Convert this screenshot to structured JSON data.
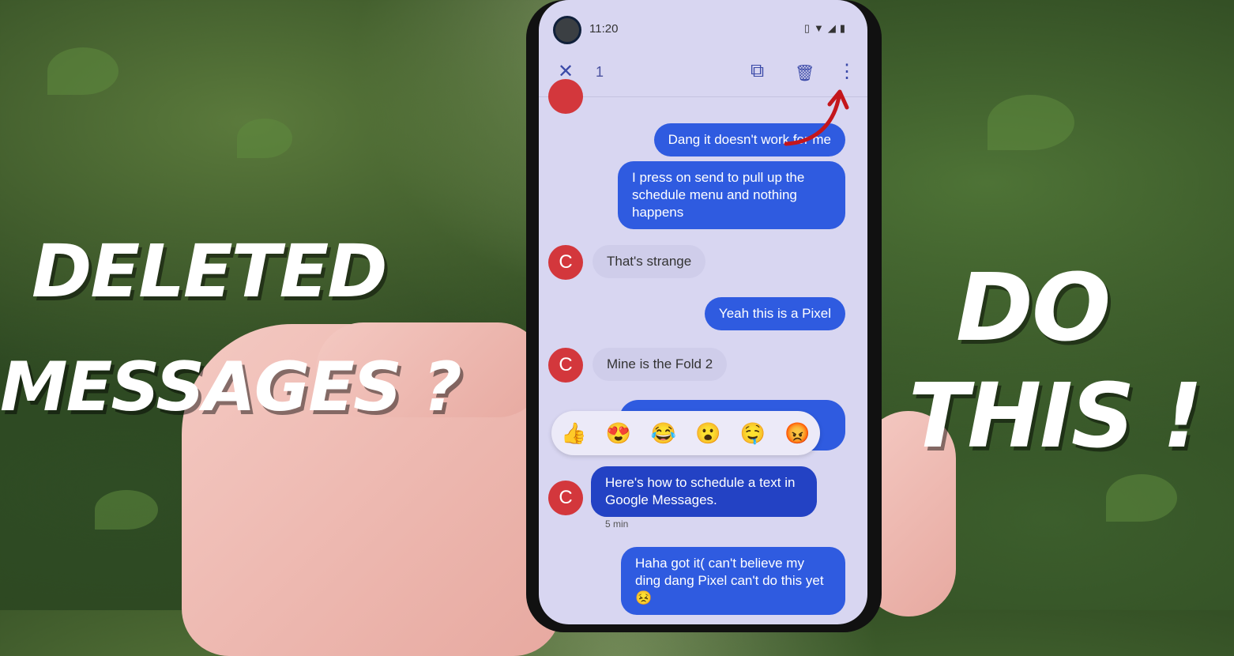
{
  "overlay": {
    "left_line1": "DELETED",
    "left_line2": "MESSAGES ?",
    "right_line1": "DO",
    "right_line2": "THIS !"
  },
  "status_bar": {
    "time": "11:20",
    "icons": [
      "vibrate-icon",
      "wifi-icon",
      "signal-icon",
      "battery-icon"
    ]
  },
  "action_bar": {
    "selected_count": "1",
    "close_icon": "✕",
    "copy_icon": "⧉",
    "delete_icon": "🗑",
    "more_icon": "⋮"
  },
  "messages": [
    {
      "direction": "outgoing",
      "text": "Dang it doesn't work for me"
    },
    {
      "direction": "outgoing",
      "text": "I press on send to pull up the schedule menu and nothing happens"
    },
    {
      "direction": "incoming",
      "avatar": "C",
      "text": "That's strange"
    },
    {
      "direction": "outgoing",
      "text": "Yeah this is a Pixel"
    },
    {
      "direction": "incoming",
      "avatar": "C",
      "text": "Mine is the Fold 2"
    },
    {
      "direction": "incoming",
      "avatar": "C",
      "text": "Here's how to schedule a text in Google Messages.",
      "timestamp": "5 min",
      "selected": true
    },
    {
      "direction": "outgoing",
      "text": "Haha got it( can't believe my ding dang Pixel can't do this yet 😣"
    }
  ],
  "reactions": [
    "👍",
    "😍",
    "😂",
    "😮",
    "🤤",
    "😡"
  ],
  "colors": {
    "outgoing_bubble": "#2f5be0",
    "selected_bubble": "#2342c4",
    "avatar": "#d3373c",
    "screen_bg": "#d8d6f1",
    "arrow": "#c4161c"
  }
}
